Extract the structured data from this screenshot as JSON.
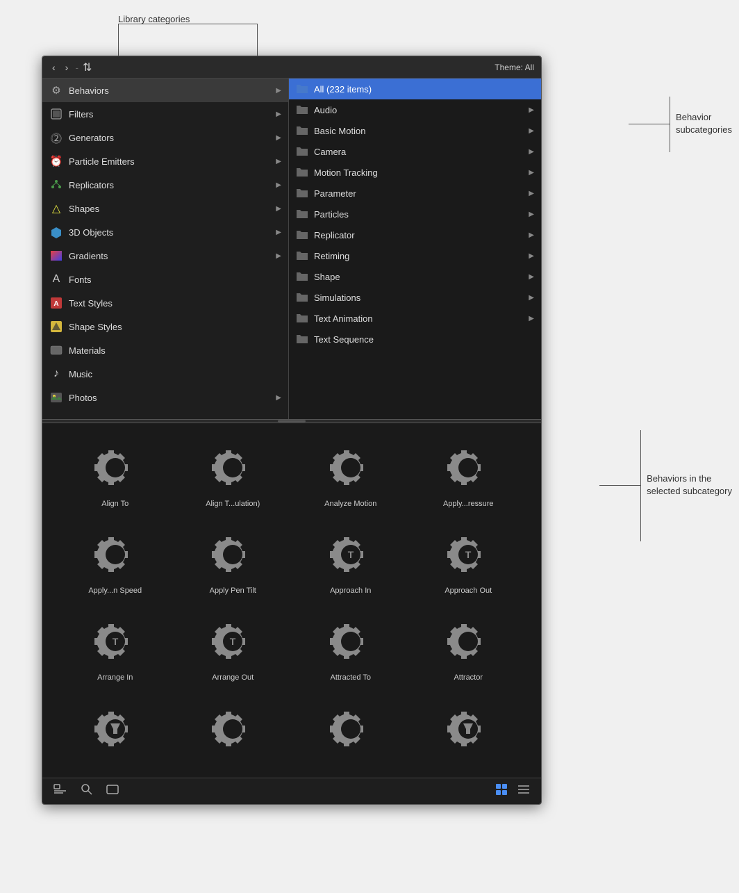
{
  "header": {
    "theme_label": "Theme: All",
    "nav": {
      "back": "‹",
      "forward": "›",
      "separator": "-",
      "arrange": "⇅"
    }
  },
  "sidebar": {
    "items": [
      {
        "id": "behaviors",
        "label": "Behaviors",
        "icon": "⚙",
        "active": true,
        "hasChevron": true
      },
      {
        "id": "filters",
        "label": "Filters",
        "icon": "🔲",
        "active": false,
        "hasChevron": true
      },
      {
        "id": "generators",
        "label": "Generators",
        "icon": "②",
        "active": false,
        "hasChevron": true
      },
      {
        "id": "particle-emitters",
        "label": "Particle Emitters",
        "icon": "⏰",
        "active": false,
        "hasChevron": true
      },
      {
        "id": "replicators",
        "label": "Replicators",
        "icon": "❋",
        "active": false,
        "hasChevron": true
      },
      {
        "id": "shapes",
        "label": "Shapes",
        "icon": "△",
        "active": false,
        "hasChevron": true
      },
      {
        "id": "3d-objects",
        "label": "3D Objects",
        "icon": "⬡",
        "active": false,
        "hasChevron": true
      },
      {
        "id": "gradients",
        "label": "Gradients",
        "icon": "▣",
        "active": false,
        "hasChevron": true
      },
      {
        "id": "fonts",
        "label": "Fonts",
        "icon": "A",
        "active": false,
        "hasChevron": false
      },
      {
        "id": "text-styles",
        "label": "Text Styles",
        "icon": "Ⓐ",
        "active": false,
        "hasChevron": false
      },
      {
        "id": "shape-styles",
        "label": "Shape Styles",
        "icon": "◪",
        "active": false,
        "hasChevron": false
      },
      {
        "id": "materials",
        "label": "Materials",
        "icon": "▭",
        "active": false,
        "hasChevron": false
      },
      {
        "id": "music",
        "label": "Music",
        "icon": "♪",
        "active": false,
        "hasChevron": false
      },
      {
        "id": "photos",
        "label": "Photos",
        "icon": "🖼",
        "active": false,
        "hasChevron": true
      }
    ]
  },
  "subcategories": {
    "items": [
      {
        "id": "all",
        "label": "All (232 items)",
        "active": true,
        "hasChevron": false
      },
      {
        "id": "audio",
        "label": "Audio",
        "active": false,
        "hasChevron": true
      },
      {
        "id": "basic-motion",
        "label": "Basic Motion",
        "active": false,
        "hasChevron": true
      },
      {
        "id": "camera",
        "label": "Camera",
        "active": false,
        "hasChevron": true
      },
      {
        "id": "motion-tracking",
        "label": "Motion Tracking",
        "active": false,
        "hasChevron": true
      },
      {
        "id": "parameter",
        "label": "Parameter",
        "active": false,
        "hasChevron": true
      },
      {
        "id": "particles",
        "label": "Particles",
        "active": false,
        "hasChevron": true
      },
      {
        "id": "replicator",
        "label": "Replicator",
        "active": false,
        "hasChevron": true
      },
      {
        "id": "retiming",
        "label": "Retiming",
        "active": false,
        "hasChevron": true
      },
      {
        "id": "shape",
        "label": "Shape",
        "active": false,
        "hasChevron": true
      },
      {
        "id": "simulations",
        "label": "Simulations",
        "active": false,
        "hasChevron": true
      },
      {
        "id": "text-animation",
        "label": "Text Animation",
        "active": false,
        "hasChevron": true
      },
      {
        "id": "text-sequence",
        "label": "Text Sequence",
        "active": false,
        "hasChevron": false
      }
    ]
  },
  "grid": {
    "items": [
      {
        "id": "align-to",
        "label": "Align To",
        "hasT": false,
        "hasFilter": false
      },
      {
        "id": "align-t-ulation",
        "label": "Align T...ulation)",
        "hasT": false,
        "hasFilter": false
      },
      {
        "id": "analyze-motion",
        "label": "Analyze Motion",
        "hasT": false,
        "hasFilter": false
      },
      {
        "id": "apply-ressure",
        "label": "Apply...ressure",
        "hasT": false,
        "hasFilter": false
      },
      {
        "id": "apply-n-speed",
        "label": "Apply...n Speed",
        "hasT": false,
        "hasFilter": false
      },
      {
        "id": "apply-pen-tilt",
        "label": "Apply Pen Tilt",
        "hasT": false,
        "hasFilter": false
      },
      {
        "id": "approach-in",
        "label": "Approach In",
        "hasT": true,
        "hasFilter": false
      },
      {
        "id": "approach-out",
        "label": "Approach Out",
        "hasT": true,
        "hasFilter": false
      },
      {
        "id": "arrange-in",
        "label": "Arrange In",
        "hasT": true,
        "hasFilter": false
      },
      {
        "id": "arrange-out",
        "label": "Arrange Out",
        "hasT": true,
        "hasFilter": false
      },
      {
        "id": "attracted-to",
        "label": "Attracted To",
        "hasT": false,
        "hasFilter": false
      },
      {
        "id": "attractor",
        "label": "Attractor",
        "hasT": false,
        "hasFilter": false
      },
      {
        "id": "row4-1",
        "label": "",
        "hasT": false,
        "hasFilter": true
      },
      {
        "id": "row4-2",
        "label": "",
        "hasT": false,
        "hasFilter": false
      },
      {
        "id": "row4-3",
        "label": "",
        "hasT": false,
        "hasFilter": false
      },
      {
        "id": "row4-4",
        "label": "",
        "hasT": false,
        "hasFilter": true
      }
    ]
  },
  "toolbar": {
    "add_to_library": "⊞",
    "search": "🔍",
    "preview": "▭",
    "grid_view_label": "⊞",
    "list_view_label": "≡"
  },
  "annotations": {
    "library_categories": "Library categories",
    "behavior_subcategories": "Behavior subcategories",
    "behaviors_in_subcategory": "Behaviors in the\nselected subcategory"
  }
}
